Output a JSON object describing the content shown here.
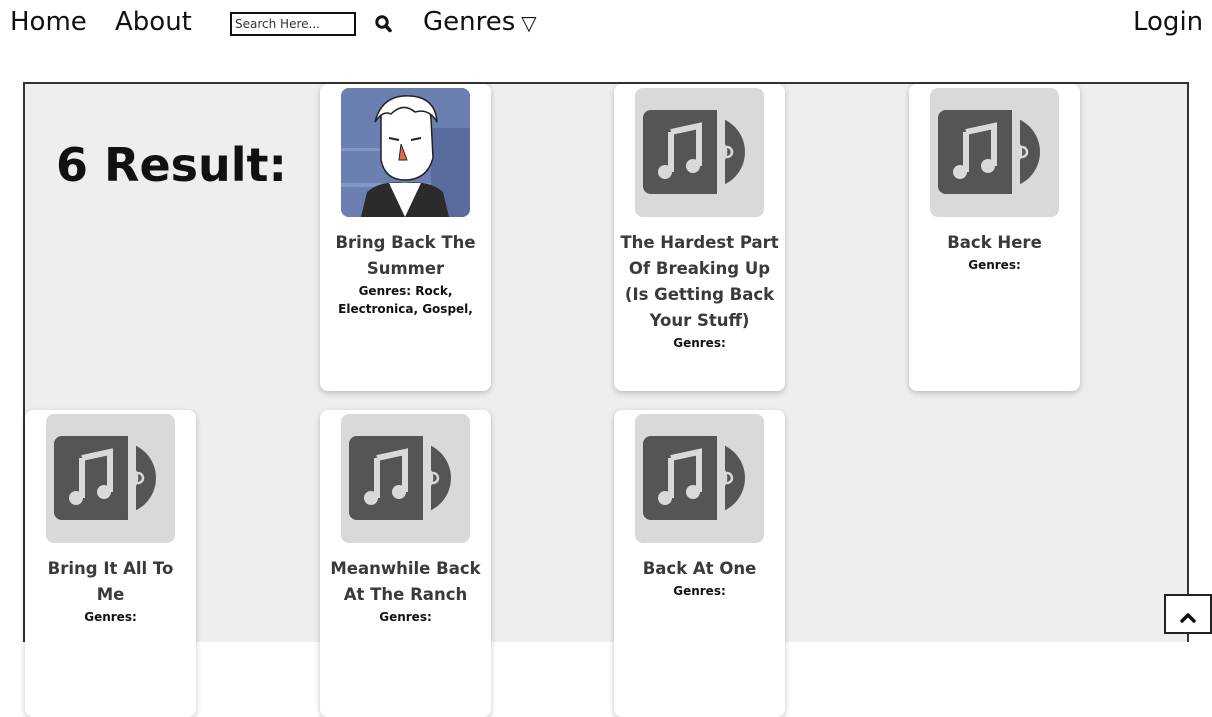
{
  "nav": {
    "home_label": "Home",
    "about_label": "About",
    "search_placeholder": "Search Here...",
    "genres_label": "Genres",
    "genres_arrow": "▽",
    "login_label": "Login"
  },
  "results": {
    "count_label": "6 Result:",
    "items": [
      {
        "title": "Bring Back The Summer",
        "genres": "Genres: Rock, Electronica, Gospel,",
        "thumbnail": "cartoon-portrait"
      },
      {
        "title": "The Hardest Part Of Breaking Up (Is Getting Back Your Stuff)",
        "genres": "Genres:",
        "thumbnail": "music-disc-icon"
      },
      {
        "title": "Back Here",
        "genres": "Genres:",
        "thumbnail": "music-disc-icon"
      },
      {
        "title": "Bring It All To Me",
        "genres": "Genres:",
        "thumbnail": "music-disc-icon"
      },
      {
        "title": "Meanwhile Back At The Ranch",
        "genres": "Genres:",
        "thumbnail": "music-disc-icon"
      },
      {
        "title": "Back At One",
        "genres": "Genres:",
        "thumbnail": "music-disc-icon"
      }
    ]
  },
  "icons": {
    "search": "search-icon",
    "scroll_top": "chevron-up-icon"
  },
  "colors": {
    "panel_bg": "#eeeeee",
    "placeholder_bg": "#d9d9d9",
    "icon_fill": "#555555",
    "title_text": "#3a3a3a"
  }
}
